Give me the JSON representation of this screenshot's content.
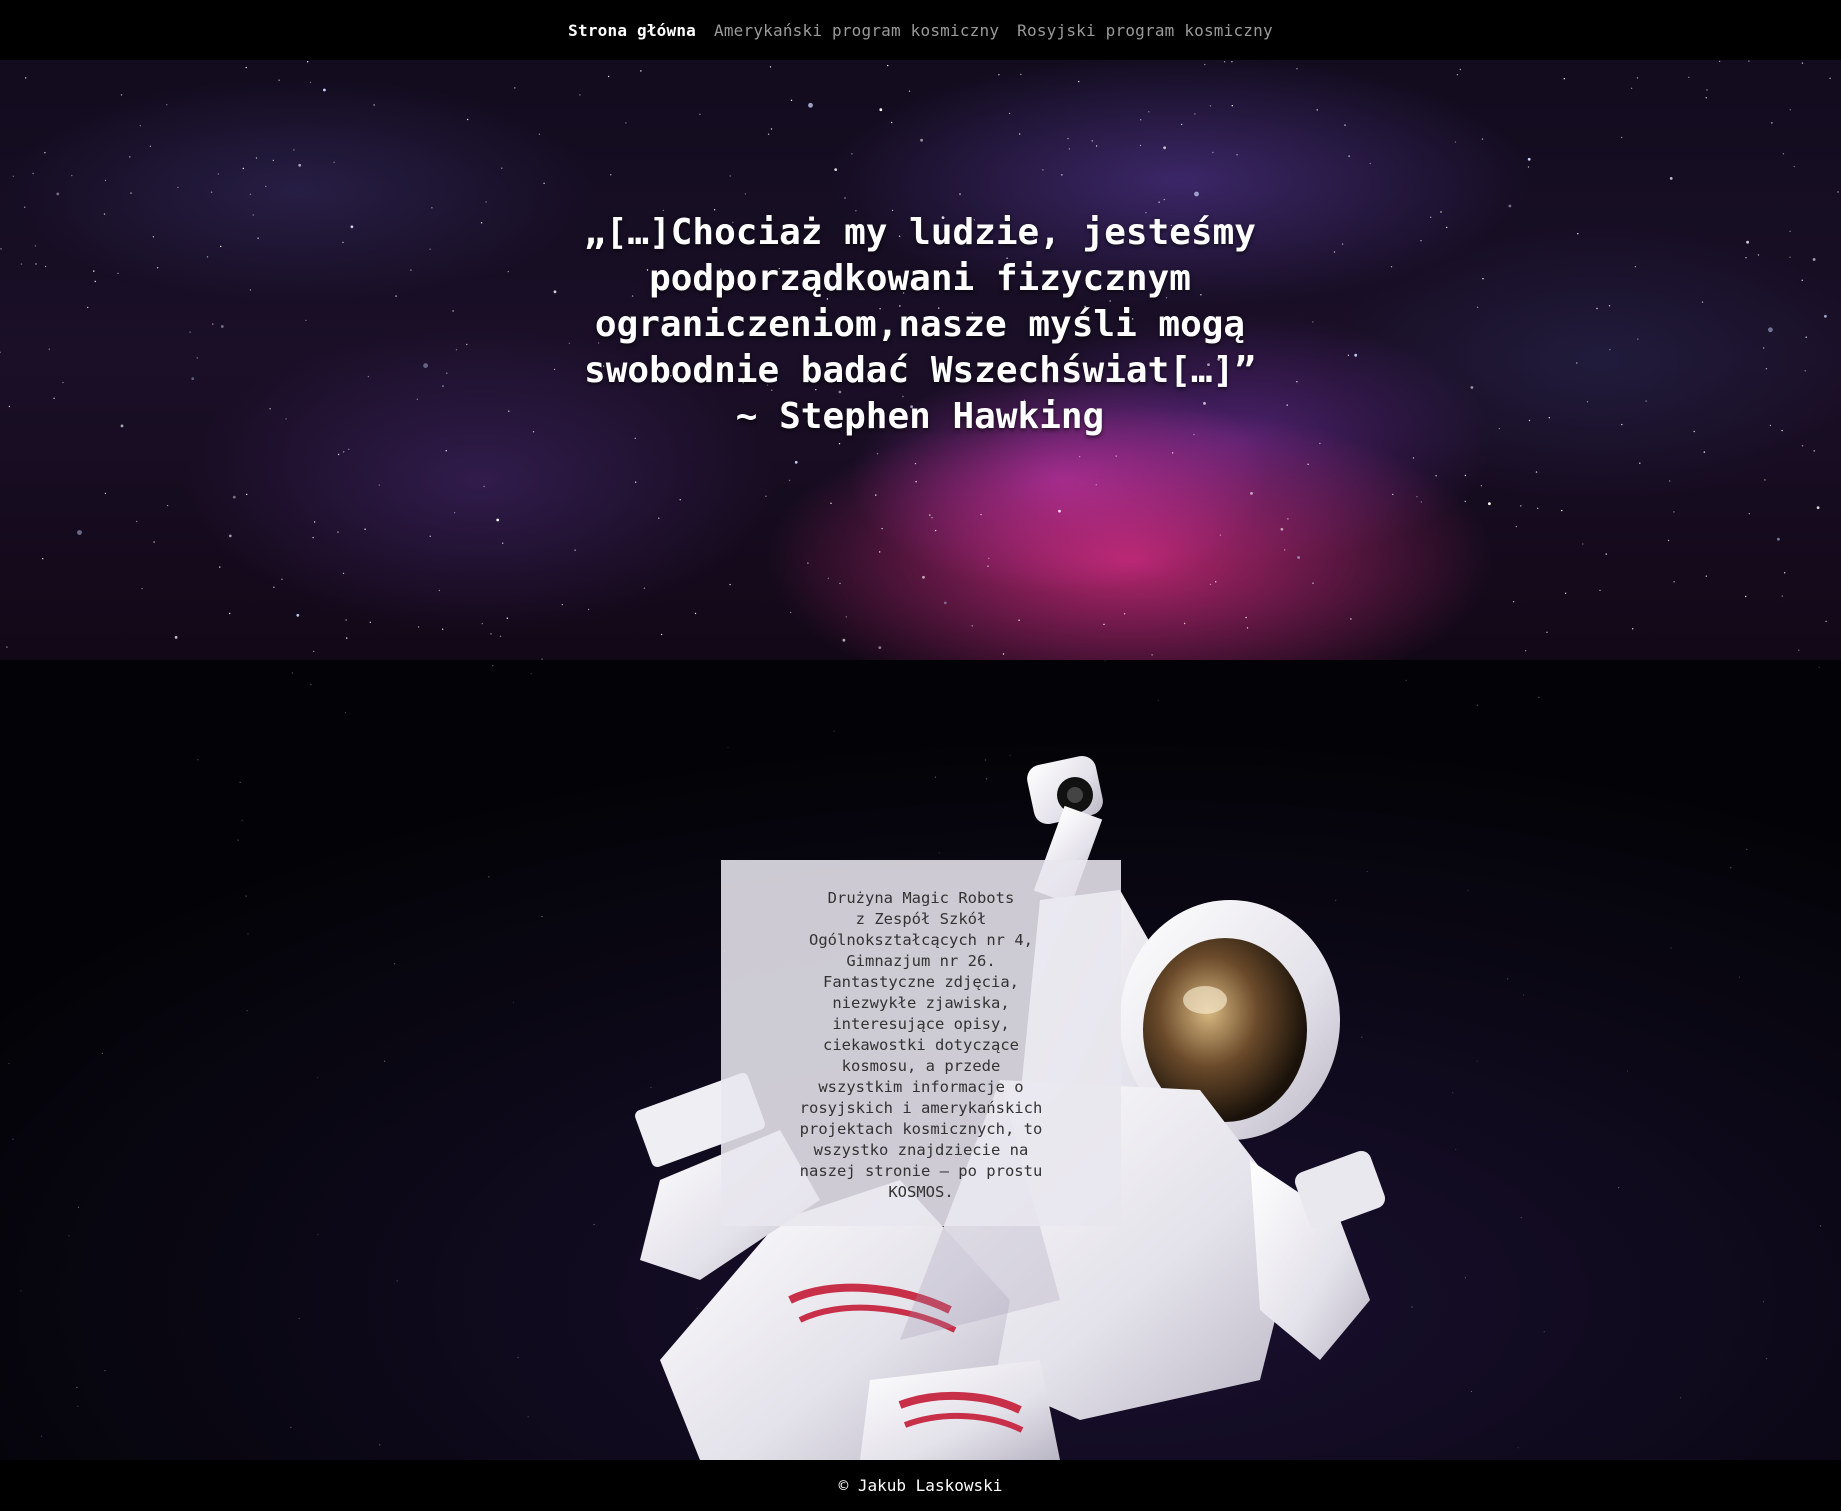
{
  "nav": {
    "items": [
      {
        "label": "Strona główna",
        "active": true
      },
      {
        "label": "Amerykański program kosmiczny",
        "active": false
      },
      {
        "label": "Rosyjski program kosmiczny",
        "active": false
      }
    ]
  },
  "hero": {
    "quote_lines": [
      "„[…]Chociaż my ludzie, jesteśmy",
      "podporządkowani fizycznym",
      "ograniczeniom,nasze myśli mogą",
      "swobodnie badać Wszechświat[…]”",
      "~ Stephen Hawking"
    ]
  },
  "info": {
    "lines": [
      "Drużyna Magic Robots",
      "z Zespół Szkół",
      "Ogólnokształcących nr 4,",
      "Gimnazjum nr 26.",
      "Fantastyczne zdjęcia,",
      "niezwykłe zjawiska,",
      "interesujące opisy,",
      "ciekawostki dotyczące",
      "kosmosu, a przede",
      "wszystkim informacje o",
      "rosyjskich i amerykańskich",
      "projektach kosmicznych, to",
      "wszystko znajdziecie na",
      "naszej stronie – po prostu",
      "KOSMOS."
    ]
  },
  "footer": {
    "text": "© Jakub Laskowski"
  },
  "colors": {
    "background": "#000000",
    "nebula_pink": "#ec308c",
    "nebula_purple": "#5a3ca0",
    "infobox_bg": "#e8e6ee"
  }
}
